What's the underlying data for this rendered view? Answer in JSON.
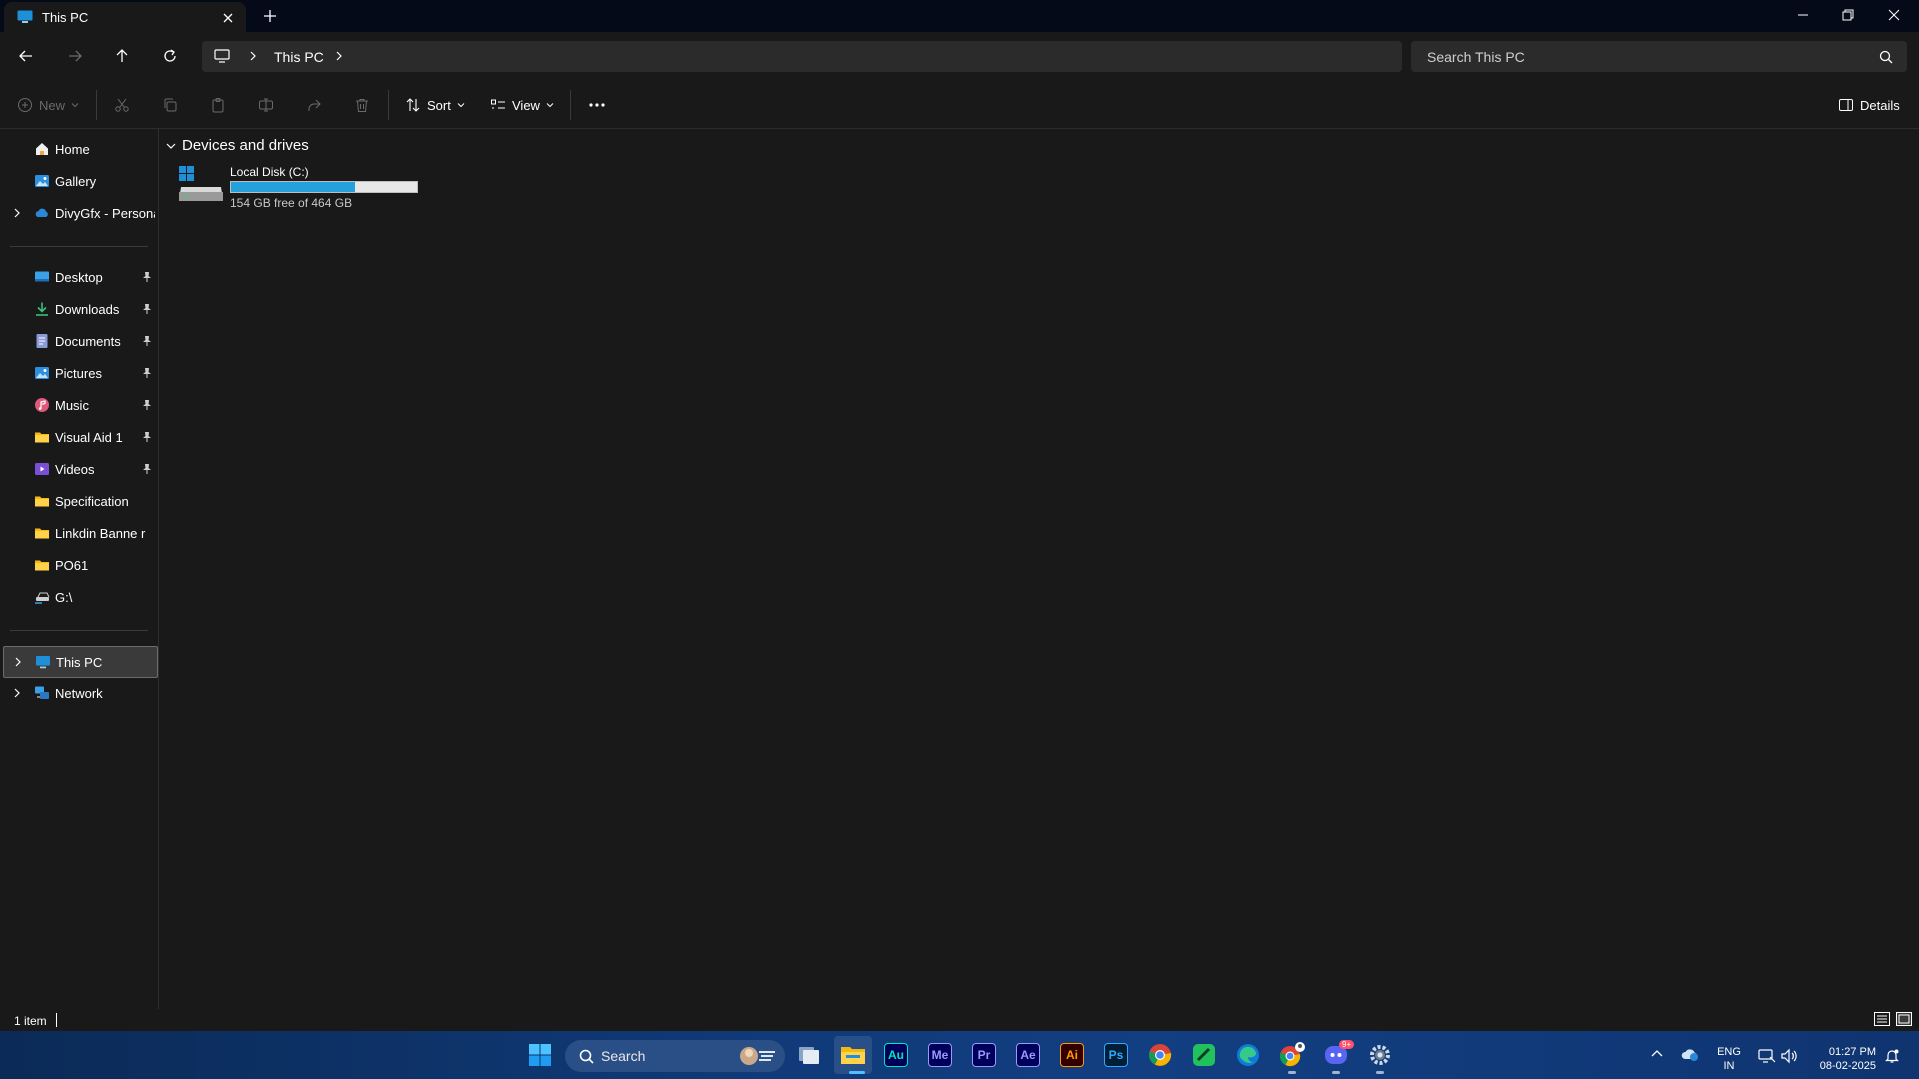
{
  "window": {
    "tab_title": "This PC",
    "controls": {
      "minimize": "minimize",
      "maximize": "restore",
      "close": "close"
    }
  },
  "address": {
    "crumbs": [
      "This PC"
    ],
    "search_placeholder": "Search This PC"
  },
  "command_bar": {
    "new_label": "New",
    "sort_label": "Sort",
    "view_label": "View",
    "details_label": "Details"
  },
  "sidebar": {
    "top_items": [
      {
        "label": "Home",
        "icon": "home-icon"
      },
      {
        "label": "Gallery",
        "icon": "gallery-icon"
      },
      {
        "label": "DivyGfx - Personal",
        "icon": "onedrive-icon"
      }
    ],
    "quick_access": [
      {
        "label": "Desktop",
        "icon": "desktop-icon"
      },
      {
        "label": "Downloads",
        "icon": "downloads-icon"
      },
      {
        "label": "Documents",
        "icon": "documents-icon"
      },
      {
        "label": "Pictures",
        "icon": "pictures-icon"
      },
      {
        "label": "Music",
        "icon": "music-icon"
      },
      {
        "label": "Visual Aid 1",
        "icon": "folder-icon"
      },
      {
        "label": "Videos",
        "icon": "videos-icon"
      },
      {
        "label": "Specification",
        "icon": "folder-icon"
      },
      {
        "label": "Linkdin Banne r",
        "icon": "folder-icon"
      },
      {
        "label": "PO61",
        "icon": "folder-icon"
      },
      {
        "label": "G:\\",
        "icon": "network-drive-icon"
      }
    ],
    "bottom_items": [
      {
        "label": "This PC",
        "icon": "this-pc-icon"
      },
      {
        "label": "Network",
        "icon": "network-icon"
      }
    ]
  },
  "content": {
    "group_title": "Devices and drives",
    "drive": {
      "name": "Local Disk (C:)",
      "free_text": "154 GB free of 464 GB",
      "used_fraction": 0.668
    }
  },
  "status": {
    "item_count": "1 item"
  },
  "taskbar": {
    "search_label": "Search",
    "apps": [
      {
        "name": "Au",
        "color": "#00e4bb",
        "bg": "#00005b"
      },
      {
        "name": "Me",
        "color": "#9999ff",
        "bg": "#00005b"
      },
      {
        "name": "Pr",
        "color": "#9999ff",
        "bg": "#00005b"
      },
      {
        "name": "Ae",
        "color": "#9999ff",
        "bg": "#00005b"
      },
      {
        "name": "Ai",
        "color": "#ff9a00",
        "bg": "#330000"
      },
      {
        "name": "Ps",
        "color": "#31a8ff",
        "bg": "#001e36"
      }
    ],
    "language": "ENG",
    "region": "IN",
    "time": "01:27 PM",
    "date": "08-02-2025",
    "discord_badge": "9+"
  }
}
